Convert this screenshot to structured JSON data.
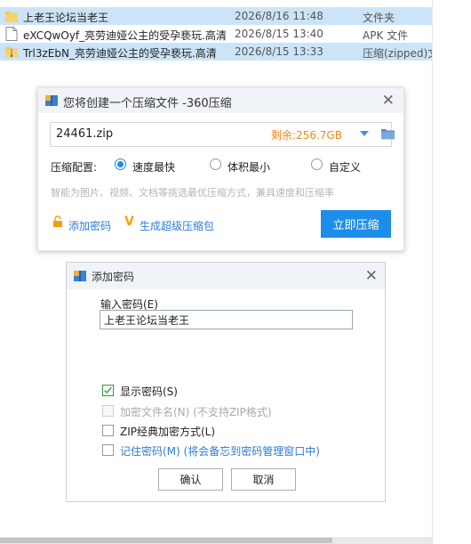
{
  "files": [
    {
      "name": "上老王论坛当老王",
      "date": "2026/8/16 11:48",
      "type": "文件夹",
      "icon": "folder-icon",
      "selected": true
    },
    {
      "name": "eXCQwOyf_亮劳迪娅公主的受孕亵玩.高清",
      "date": "2026/8/15 13:40",
      "type": "APK 文件",
      "icon": "file-icon",
      "selected": false
    },
    {
      "name": "Trl3zEbN_亮劳迪娅公主的受孕亵玩.高清",
      "date": "2026/8/15 13:33",
      "type": "压缩(zipped)文",
      "icon": "zip-icon",
      "selected": true
    }
  ],
  "compress_dialog": {
    "title": "您将创建一个压缩文件 -360压缩",
    "filename": "24461.zip",
    "remaining": "剩余:256.7GB",
    "config_label": "压缩配置:",
    "options": [
      {
        "label": "速度最快",
        "selected": true
      },
      {
        "label": "体积最小",
        "selected": false
      },
      {
        "label": "自定义",
        "selected": false
      }
    ],
    "hint": "智能为图片、视频、文档等挑选最优压缩方式，兼具速度和压缩率",
    "add_password": "添加密码",
    "super_package": "生成超级压缩包",
    "compress_button": "立即压缩"
  },
  "password_dialog": {
    "title": "添加密码",
    "input_label": "输入密码(E)",
    "password_value": "上老王论坛当老王",
    "checkboxes": [
      {
        "label": "显示密码(S)",
        "checked": true,
        "disabled": false
      },
      {
        "label": "加密文件名(N) (不支持ZIP格式)",
        "checked": false,
        "disabled": true
      },
      {
        "label": "ZIP经典加密方式(L)",
        "checked": false,
        "disabled": false
      },
      {
        "label": "记住密码(M) (将会备忘到密码管理窗口中)",
        "checked": false,
        "disabled": false
      }
    ],
    "ok_button": "确认",
    "cancel_button": "取消"
  },
  "colors": {
    "accent": "#1c8eea",
    "link": "#2d7cd2",
    "remaining": "#e8891b",
    "selection": "#cce4f7"
  }
}
